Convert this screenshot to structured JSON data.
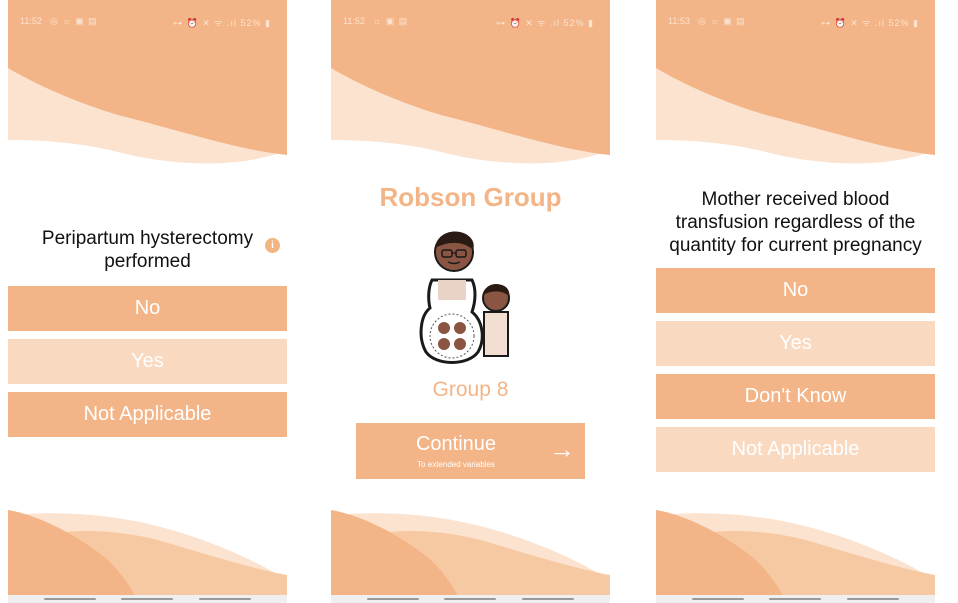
{
  "screen1": {
    "status": {
      "time": "11:52",
      "left_icons": "◎ ☼ ▣ ▤",
      "right_icons": "⊶ ⏰ ✕ ᯤ .ıl 52% ▮"
    },
    "question": "Peripartum hysterectomy performed",
    "info_icon": "i",
    "options": [
      {
        "label": "No",
        "style": "dark"
      },
      {
        "label": "Yes",
        "style": "light"
      },
      {
        "label": "Not Applicable",
        "style": "dark"
      }
    ]
  },
  "screen2": {
    "status": {
      "time": "11:52",
      "left_icons": "☼ ▣ ▤",
      "right_icons": "⊶ ⏰ ✕ ᯤ .ıl 52% ▮"
    },
    "title": "Robson Group",
    "group": "Group 8",
    "continue": {
      "label": "Continue",
      "sub": "To extended variables",
      "arrow": "→"
    }
  },
  "screen3": {
    "status": {
      "time": "11:53",
      "left_icons": "◎ ☼ ▣ ▤",
      "right_icons": "⊶ ⏰ ✕ ᯤ .ıl 52% ▮"
    },
    "question": "Mother received  blood transfusion regardless of the quantity for current pregnancy",
    "options": [
      {
        "label": "No",
        "style": "dark"
      },
      {
        "label": "Yes",
        "style": "light"
      },
      {
        "label": "Don't Know",
        "style": "dark"
      },
      {
        "label": "Not Applicable",
        "style": "light"
      }
    ]
  },
  "colors": {
    "accent": "#f3b587",
    "accent_light": "#f9d9c0",
    "wave_pale": "#fbe3d0"
  }
}
